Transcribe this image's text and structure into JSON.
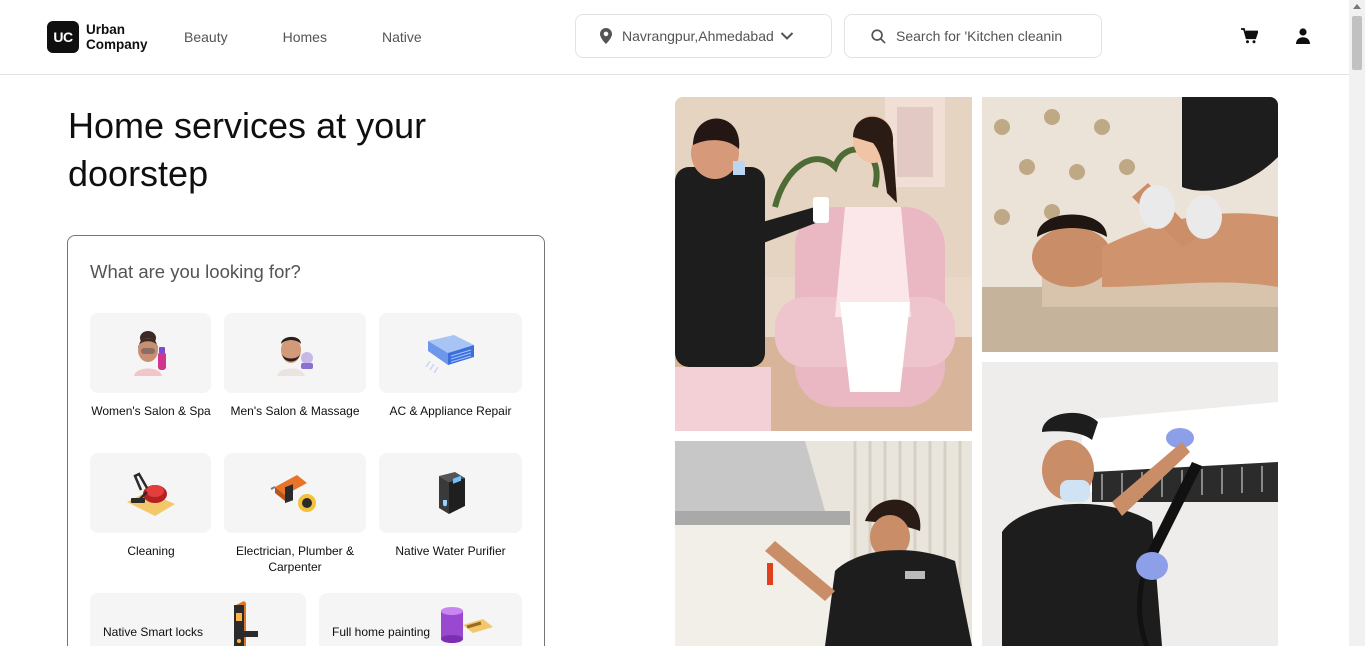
{
  "brand": {
    "logo_mark": "UC",
    "name_line1": "Urban",
    "name_line2": "Company"
  },
  "nav": {
    "items": [
      "Beauty",
      "Homes",
      "Native"
    ]
  },
  "location": {
    "value": "Navrangpur,Ahmedabad",
    "icon": "location-pin-icon"
  },
  "search": {
    "placeholder": "Search for 'Kitchen cleanin",
    "icon": "search-icon"
  },
  "header_actions": {
    "cart_icon": "cart-icon",
    "account_icon": "user-icon"
  },
  "hero": {
    "title": "Home services at your doorstep"
  },
  "panel": {
    "title": "What are you looking for?",
    "services": [
      {
        "label": "Women's Salon & Spa",
        "icon": "women-salon-icon"
      },
      {
        "label": "Men's Salon & Massage",
        "icon": "men-salon-icon"
      },
      {
        "label": "AC & Appliance Repair",
        "icon": "ac-icon"
      },
      {
        "label": "Cleaning",
        "icon": "vacuum-icon"
      },
      {
        "label": "Electrician, Plumber & Carpenter",
        "icon": "drill-icon"
      },
      {
        "label": "Native Water Purifier",
        "icon": "water-purifier-icon"
      },
      {
        "label": "Native Smart locks",
        "icon": "smart-lock-icon"
      },
      {
        "label": "Full home painting",
        "icon": "paint-bucket-icon"
      }
    ]
  },
  "photos": [
    {
      "name": "salon-photo"
    },
    {
      "name": "massage-photo"
    },
    {
      "name": "kitchen-chimney-photo"
    },
    {
      "name": "ac-cleaning-photo"
    }
  ],
  "colors": {
    "text": "#0f0f0f",
    "muted": "#545454",
    "tile": "#f5f5f5",
    "border": "#e3e3e3"
  }
}
